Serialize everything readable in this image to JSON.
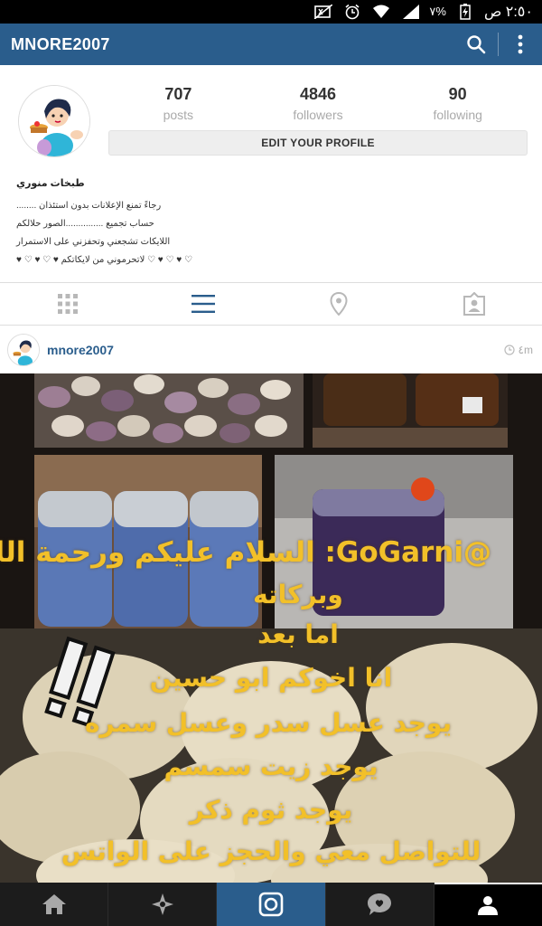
{
  "status_bar": {
    "time": "٢:٥٠ ص",
    "battery": "٧%",
    "icons": [
      "mute-icon",
      "alarm-icon",
      "wifi-icon",
      "signal-icon",
      "battery-charging-icon"
    ]
  },
  "action_bar": {
    "title": "MNORE2007",
    "icons": [
      "search-icon",
      "overflow-menu-icon"
    ]
  },
  "profile": {
    "posts_count": "707",
    "posts_label": "posts",
    "followers_count": "4846",
    "followers_label": "followers",
    "following_count": "90",
    "following_label": "following",
    "edit_label": "EDIT YOUR PROFILE",
    "full_name": "طبخات منوري",
    "bio": [
      "رجاءً تمنع الإعلانات بدون استئذان ........",
      "حساب تجميع ...............الصور حلالكم",
      "اللايكات تشجعني وتحفزني على الاستمرار",
      "♡ ♥ ♡ ♥ ♡ لاتحرموني من لايكاتكم ♥ ♡ ♥ ♡ ♥"
    ]
  },
  "tabs": [
    {
      "name": "grid-view",
      "icon": "grid-icon"
    },
    {
      "name": "list-view",
      "icon": "list-icon",
      "active": true
    },
    {
      "name": "photo-map",
      "icon": "location-pin-icon"
    },
    {
      "name": "photos-of-you",
      "icon": "tagged-person-icon"
    }
  ],
  "post": {
    "username": "mnore2007",
    "time": "٤m",
    "overlay_lines": [
      "@GoGarni: السلام عليكم ورحمة الله",
      "وبركاته",
      "اما بعد",
      "انا اخوكم ابو حسين",
      "يوجد عسل سدر وعسل سمره",
      "يوجد زيت سمسم",
      "يوجد ثوم ذكر",
      "للتواصل معي والحجز على الواتس"
    ]
  },
  "bottom_nav": [
    {
      "name": "home",
      "icon": "home-icon"
    },
    {
      "name": "explore",
      "icon": "explore-star-icon"
    },
    {
      "name": "camera",
      "icon": "camera-icon",
      "active": true
    },
    {
      "name": "news",
      "icon": "heart-bubble-icon"
    },
    {
      "name": "profile",
      "icon": "person-icon",
      "selected": true
    }
  ],
  "colors": {
    "brand_blue": "#2a5d8c",
    "overlay_text": "#f2c029"
  }
}
